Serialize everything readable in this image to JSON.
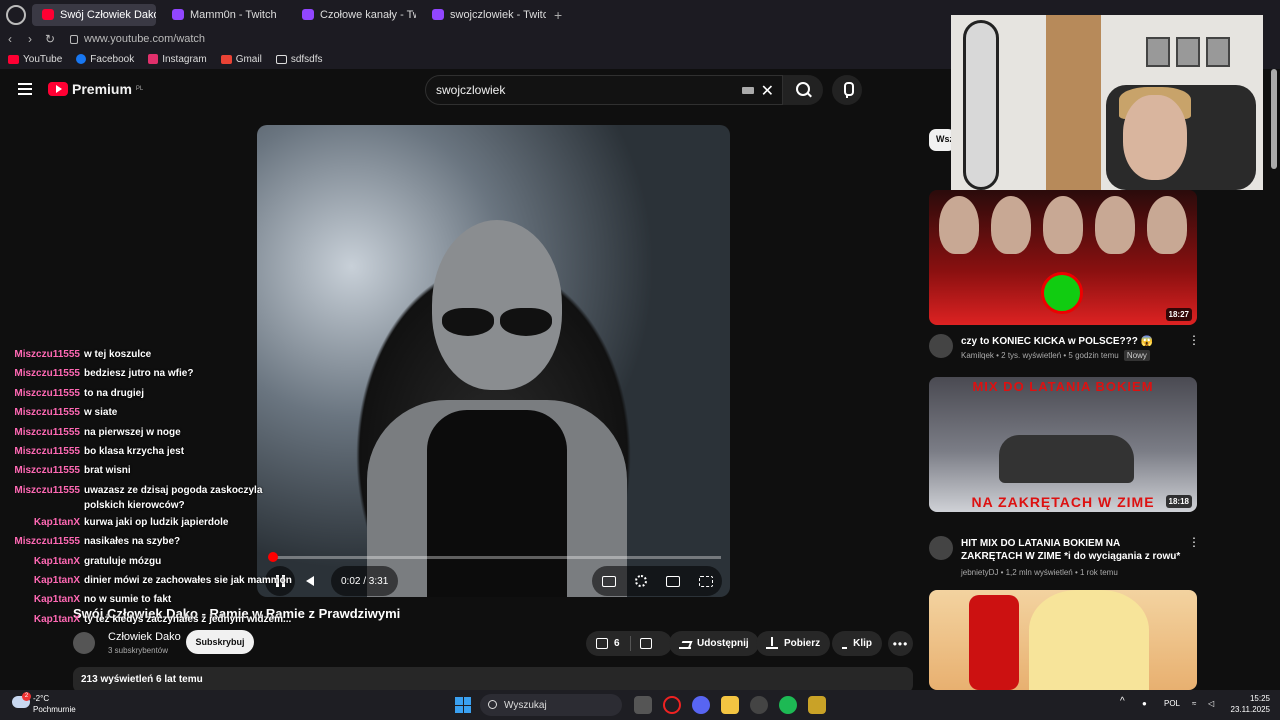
{
  "browser": {
    "tabs": [
      {
        "label": "Swój Człowiek Dako",
        "icon": "youtube-icon",
        "active": true
      },
      {
        "label": "Mamm0n - Twitch",
        "icon": "twitch-icon",
        "active": false
      },
      {
        "label": "Czołowe kanały - Twitch",
        "icon": "twitch-icon",
        "active": false
      },
      {
        "label": "swojczlowiek - Twitch",
        "icon": "twitch-icon",
        "active": false
      }
    ],
    "new_tab": "+",
    "url": "www.youtube.com/watch",
    "bookmarks": [
      "YouTube",
      "Facebook",
      "Instagram",
      "Gmail",
      "sdfsdfs"
    ]
  },
  "youtube": {
    "logo_text": "Premium",
    "logo_region": "PL",
    "search_value": "swojczlowiek"
  },
  "player": {
    "progress": 0.009,
    "time": "0:02 / 3:31"
  },
  "video": {
    "title": "Swój Człowiek Dako - Ramie w Ramie z Prawdziwymi",
    "channel_name": "Człowiek Dako",
    "subscribers": "3 subskrybentów",
    "subscribe_label": "Subskrybuj",
    "likes": "6",
    "share_label": "Udostępnij",
    "download_label": "Pobierz",
    "clip_label": "Klip",
    "more_label": "•••",
    "views_line": "213 wyświetleń  6 lat temu"
  },
  "chat": [
    {
      "user": "Miszczu11555",
      "color": "#ff69b4",
      "msg": "w tej koszulce"
    },
    {
      "user": "Miszczu11555",
      "color": "#ff69b4",
      "msg": "bedziesz jutro na wfie?"
    },
    {
      "user": "Miszczu11555",
      "color": "#ff69b4",
      "msg": "to na drugiej"
    },
    {
      "user": "Miszczu11555",
      "color": "#ff69b4",
      "msg": "w siate"
    },
    {
      "user": "Miszczu11555",
      "color": "#ff69b4",
      "msg": "na pierwszej w noge"
    },
    {
      "user": "Miszczu11555",
      "color": "#ff69b4",
      "msg": "bo klasa krzycha jest"
    },
    {
      "user": "Miszczu11555",
      "color": "#ff69b4",
      "msg": "brat wisni"
    },
    {
      "user": "Miszczu11555",
      "color": "#ff69b4",
      "msg": "uwazasz ze dzisaj pogoda zaskoczyla polskich kierowców?"
    },
    {
      "user": "Kap1tanX",
      "color": "#ff69b4",
      "msg": "kurwa jaki op ludzik japierdole"
    },
    {
      "user": "Miszczu11555",
      "color": "#ff69b4",
      "msg": "nasikałes na szybe?"
    },
    {
      "user": "Kap1tanX",
      "color": "#ff69b4",
      "msg": "gratuluje mózgu"
    },
    {
      "user": "Kap1tanX",
      "color": "#ff69b4",
      "msg": "dinier mówi ze zachowałes sie jak mammon"
    },
    {
      "user": "Kap1tanX",
      "color": "#ff69b4",
      "msg": "no w sumie to fakt"
    },
    {
      "user": "Kap1tanX",
      "color": "#ff69b4",
      "msg": "ty też kiedyś zaczynałeś z jednym widzem..."
    }
  ],
  "sidebar": {
    "filter_chip": "Wszystko",
    "recommendations": [
      {
        "title": "czy to KONIEC KICKA w POLSCE??? 😱",
        "channel": "Kamilqek",
        "meta": "2 tys. wyświetleń • 5 godzin temu",
        "badge": "Nowy",
        "duration": "18:27"
      },
      {
        "title": "HIT MIX DO LATANIA BOKIEM NA ZAKRĘTACH W ZIME *i do wyciągania z rowu*",
        "channel": "jebnietyDJ",
        "meta": "1,2 mln wyświetleń • 1 rok temu",
        "duration": "18:18",
        "thumb_top": "MIX DO LATANIA BOKIEM",
        "thumb_bottom": "NA ZAKRĘTACH W ZIME"
      }
    ]
  },
  "taskbar": {
    "weather_temp": "-2°C",
    "weather_desc": "Pochmurnie",
    "weather_badge": "2",
    "search_placeholder": "Wyszukaj",
    "language": "POL",
    "time": "15:25",
    "date": "23.11.2025"
  },
  "colors": {
    "accent": "#ff0000",
    "twitch": "#9146ff",
    "chat_user": "#ff69b4"
  }
}
